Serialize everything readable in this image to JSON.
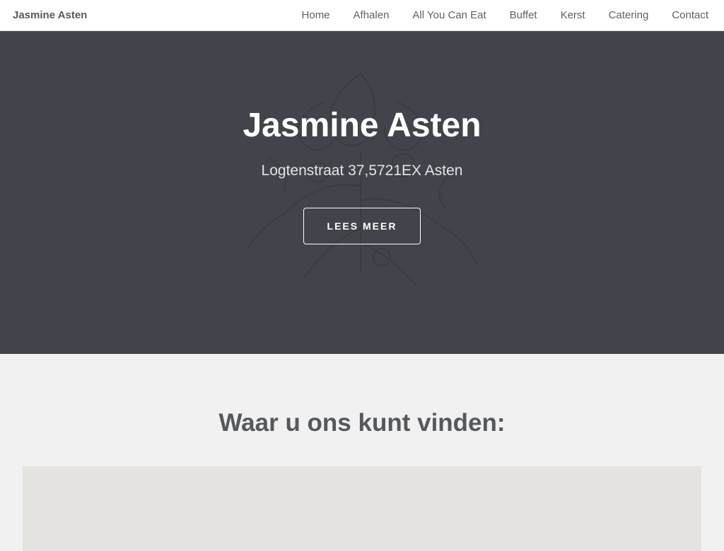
{
  "navbar": {
    "brand": "Jasmine Asten",
    "links": [
      {
        "label": "Home"
      },
      {
        "label": "Afhalen"
      },
      {
        "label": "All You Can Eat"
      },
      {
        "label": "Buffet"
      },
      {
        "label": "Kerst"
      },
      {
        "label": "Catering"
      },
      {
        "label": "Contact"
      }
    ]
  },
  "hero": {
    "title": "Jasmine Asten",
    "subtitle": "Logtenstraat 37,5721EX Asten",
    "button_label": "LEES MEER",
    "background_color": "#41444a",
    "illustration": "floral-sketch"
  },
  "location": {
    "heading": "Waar u ons kunt vinden:",
    "map": "map-embed"
  }
}
